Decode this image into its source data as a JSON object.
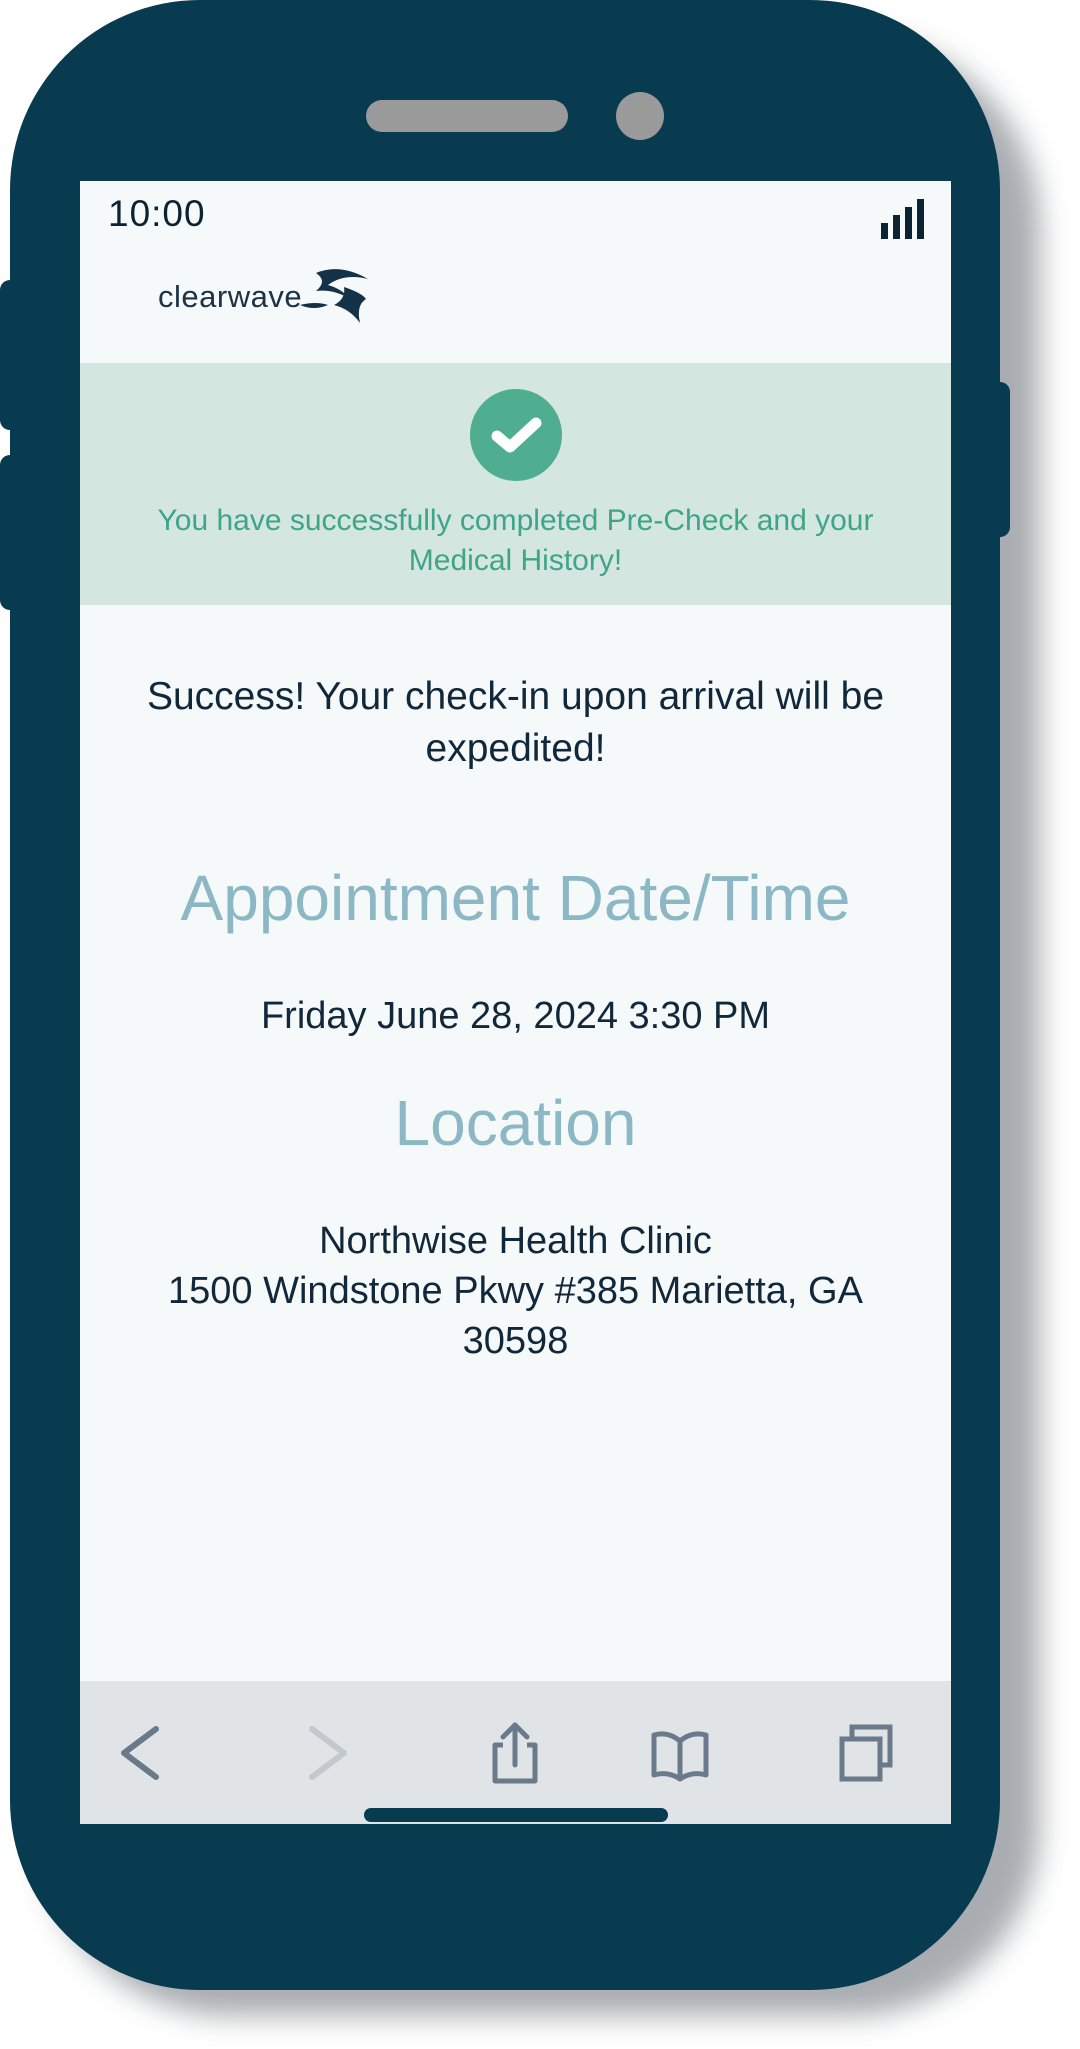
{
  "status_bar": {
    "time": "10:00",
    "signal_icon": "signal-bars-icon"
  },
  "brand": {
    "name": "clearwave",
    "mark_icon": "clearwave-logo-mark"
  },
  "banner": {
    "icon": "check-circle-icon",
    "message": "You have successfully completed Pre-Check and your Medical History!",
    "background_color": "#d3e6e0",
    "text_color": "#3fa585",
    "icon_color": "#4fae8f"
  },
  "main": {
    "success_message": "Success! Your check-in upon arrival will be expedited!",
    "appointment": {
      "heading": "Appointment Date/Time",
      "value": "Friday June 28, 2024 3:30 PM"
    },
    "location": {
      "heading": "Location",
      "name": "Northwise Health Clinic",
      "address_line": "1500 Windstone Pkwy #385 Marietta, GA",
      "postal_code": "30598"
    },
    "heading_color": "#8cb7c4"
  },
  "browser_toolbar": {
    "buttons": [
      {
        "icon": "back-arrow-icon",
        "enabled": true
      },
      {
        "icon": "forward-arrow-icon",
        "enabled": false
      },
      {
        "icon": "share-icon",
        "enabled": true
      },
      {
        "icon": "bookmarks-book-icon",
        "enabled": true
      },
      {
        "icon": "tabs-icon",
        "enabled": true
      }
    ]
  },
  "device": {
    "frame_color": "#083a50"
  }
}
